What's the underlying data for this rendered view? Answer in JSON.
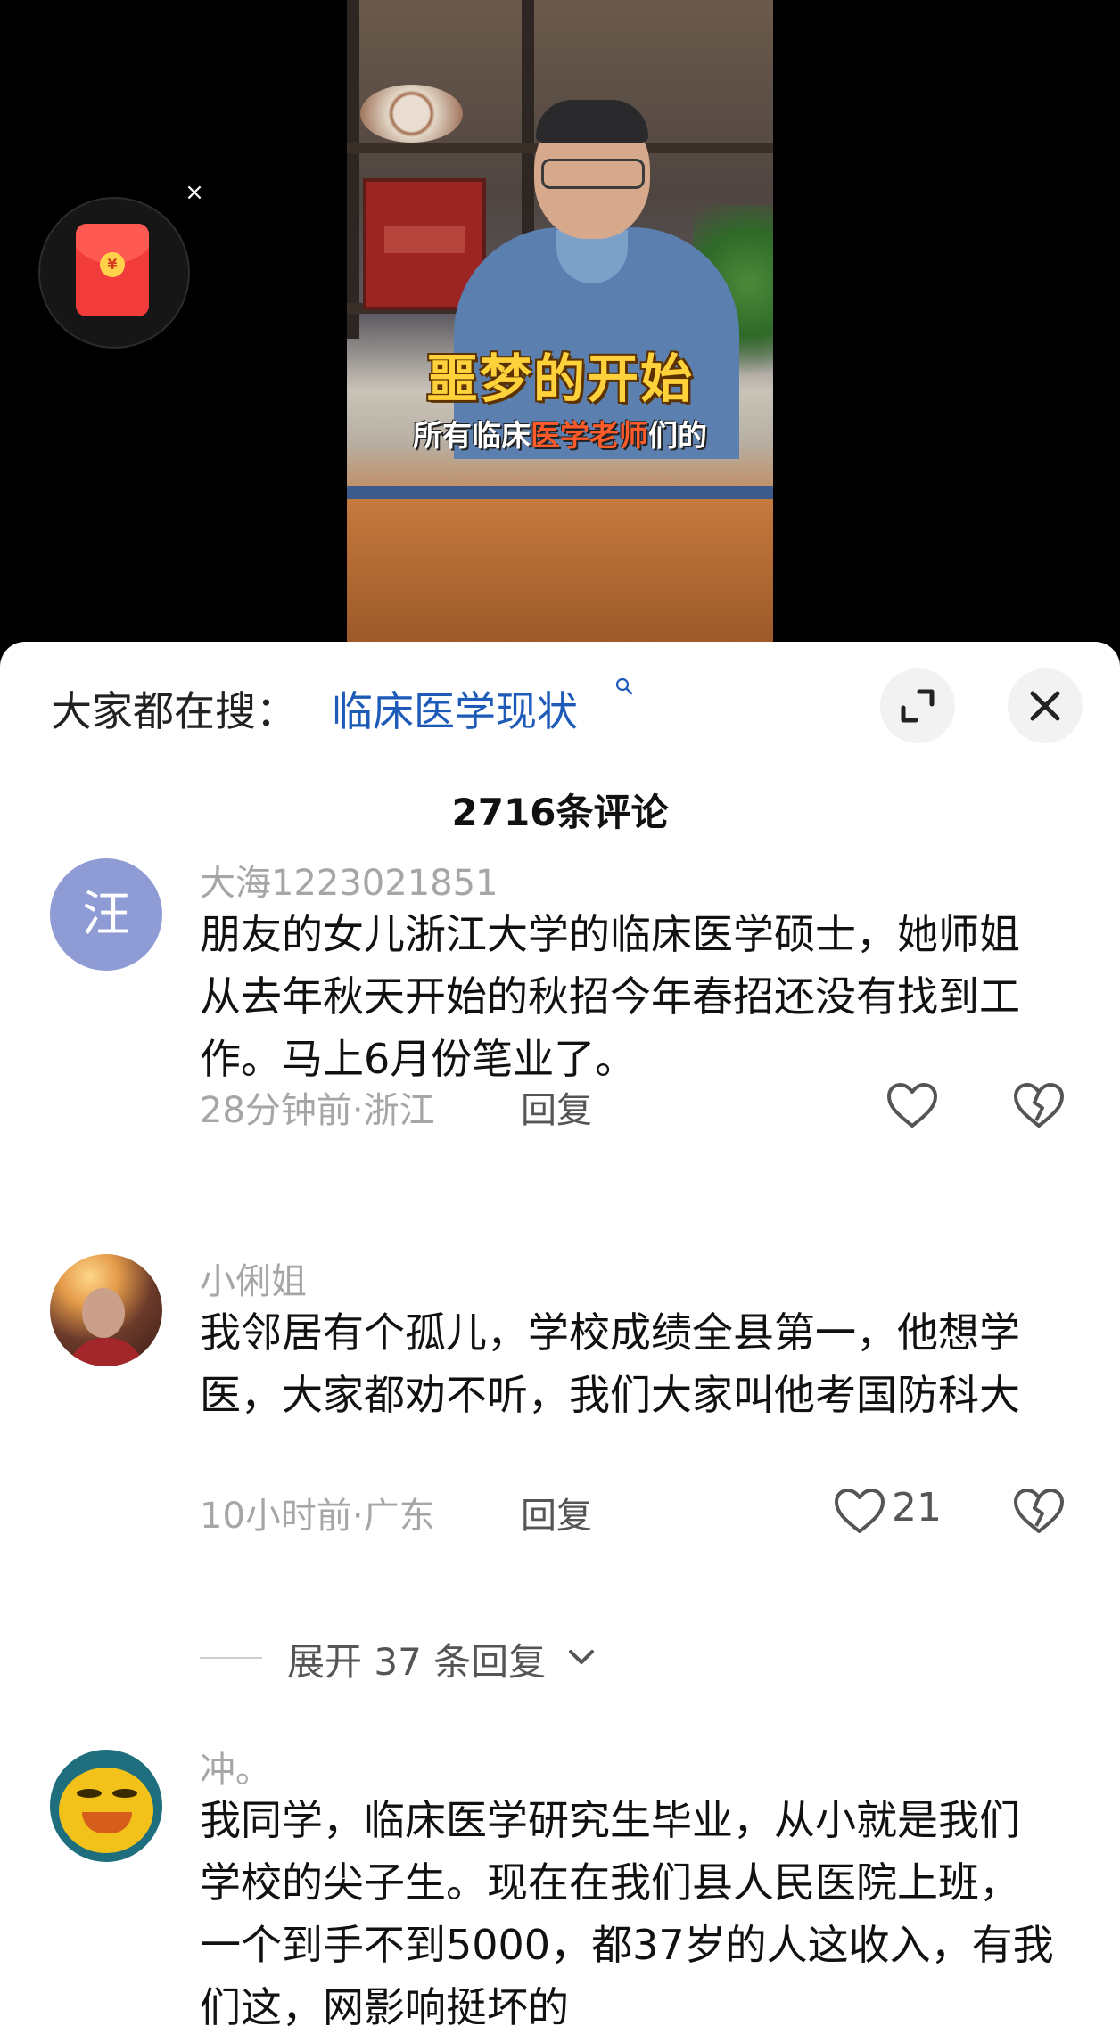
{
  "video": {
    "caption_main": "噩梦的开始",
    "caption_sub_pre": "所有临床",
    "caption_sub_highlight": "医学老师",
    "caption_sub_post": "们的",
    "highlight_color": "#ff5a2a",
    "caption_color": "#ffd23c"
  },
  "redpacket": {
    "coin_glyph": "¥",
    "close_glyph": "×",
    "icon": "red-envelope-icon"
  },
  "search": {
    "prefix": "大家都在搜：",
    "query": "临床医学现状",
    "link_color": "#1e5bb8"
  },
  "header": {
    "comment_count": "2716条评论"
  },
  "comments": [
    {
      "avatar_text": "汪",
      "avatar_color": "#8e9bd4",
      "username": "大海1223021851",
      "text": "朋友的女儿浙江大学的临床医学硕士，她师姐从去年秋天开始的秋招今年春招还没有找到工作。马上6月份笔业了。",
      "meta": "28分钟前·浙江",
      "reply": "回复",
      "likes": ""
    },
    {
      "avatar_text": "",
      "username": "小俐姐",
      "text": "我邻居有个孤儿，学校成绩全县第一，他想学医，大家都劝不听，我们大家叫他考国防科大",
      "meta": "10小时前·广东",
      "reply": "回复",
      "likes": "21",
      "expand_label": "展开 37 条回复"
    },
    {
      "avatar_text": "",
      "username": "冲。",
      "text": "我同学，临床医学研究生毕业，从小就是我们学校的尖子生。现在在我们县人民医院上班，一个到手不到5000，都37岁的人这收入，有我们这，网影响挺坏的"
    }
  ]
}
